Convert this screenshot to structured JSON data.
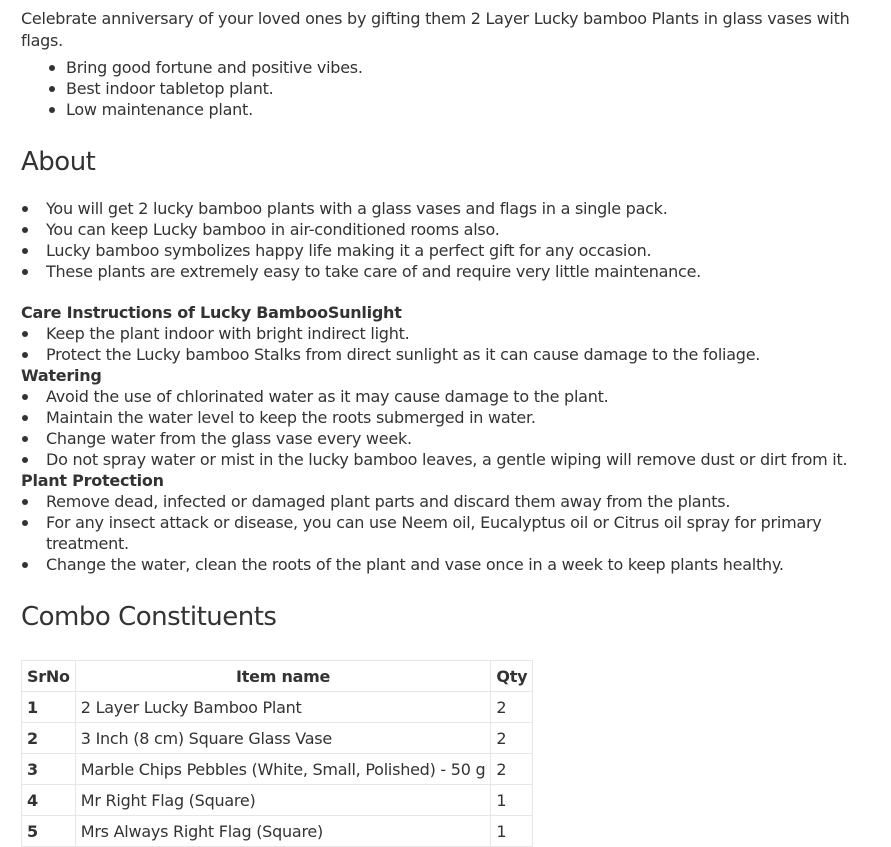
{
  "intro": "Celebrate anniversary of your loved ones by gifting them 2 Layer Lucky bamboo Plants in glass vases with flags.",
  "intro_points": [
    "Bring good fortune and positive vibes.",
    "Best indoor tabletop plant.",
    "Low maintenance plant."
  ],
  "about": {
    "heading": "About",
    "points": [
      "You will get 2 lucky bamboo plants with a glass vases and flags in a single pack.",
      "You can keep Lucky bamboo in air-conditioned rooms also.",
      "Lucky bamboo symbolizes happy life making it a perfect gift for any occasion.",
      "These plants are extremely easy to take care of and require very little maintenance."
    ]
  },
  "care": {
    "heading": "Care Instructions of Lucky BambooSunlight",
    "sunlight": [
      "Keep the plant indoor with bright indirect light.",
      "Protect the Lucky bamboo Stalks from direct sunlight as it can cause damage to the foliage."
    ],
    "watering_heading": "Watering",
    "watering": [
      "Avoid the use of chlorinated water as it may cause damage to the plant.",
      "Maintain the water level to keep the roots submerged in water.",
      "Change water from the glass vase every week.",
      "Do not spray water or mist in the lucky bamboo leaves, a gentle wiping will remove dust or dirt from it."
    ],
    "protection_heading": "Plant Protection",
    "protection": [
      "Remove dead, infected or damaged plant parts and discard them away from the plants.",
      "For any insect attack or disease, you can use Neem oil, Eucalyptus oil or Citrus oil spray for primary treatment.",
      "Change the water, clean the roots of the plant and vase once in a week to keep plants healthy."
    ]
  },
  "combo": {
    "heading": "Combo Constituents",
    "columns": [
      "SrNo",
      "Item name",
      "Qty"
    ],
    "rows": [
      [
        "1",
        "2 Layer Lucky Bamboo Plant",
        "2"
      ],
      [
        "2",
        "3 Inch (8 cm) Square Glass Vase",
        "2"
      ],
      [
        "3",
        "Marble Chips Pebbles (White, Small, Polished) - 50 g",
        "2"
      ],
      [
        "4",
        "Mr Right Flag (Square)",
        "1"
      ],
      [
        "5",
        "Mrs Always Right Flag (Square)",
        "1"
      ]
    ]
  }
}
